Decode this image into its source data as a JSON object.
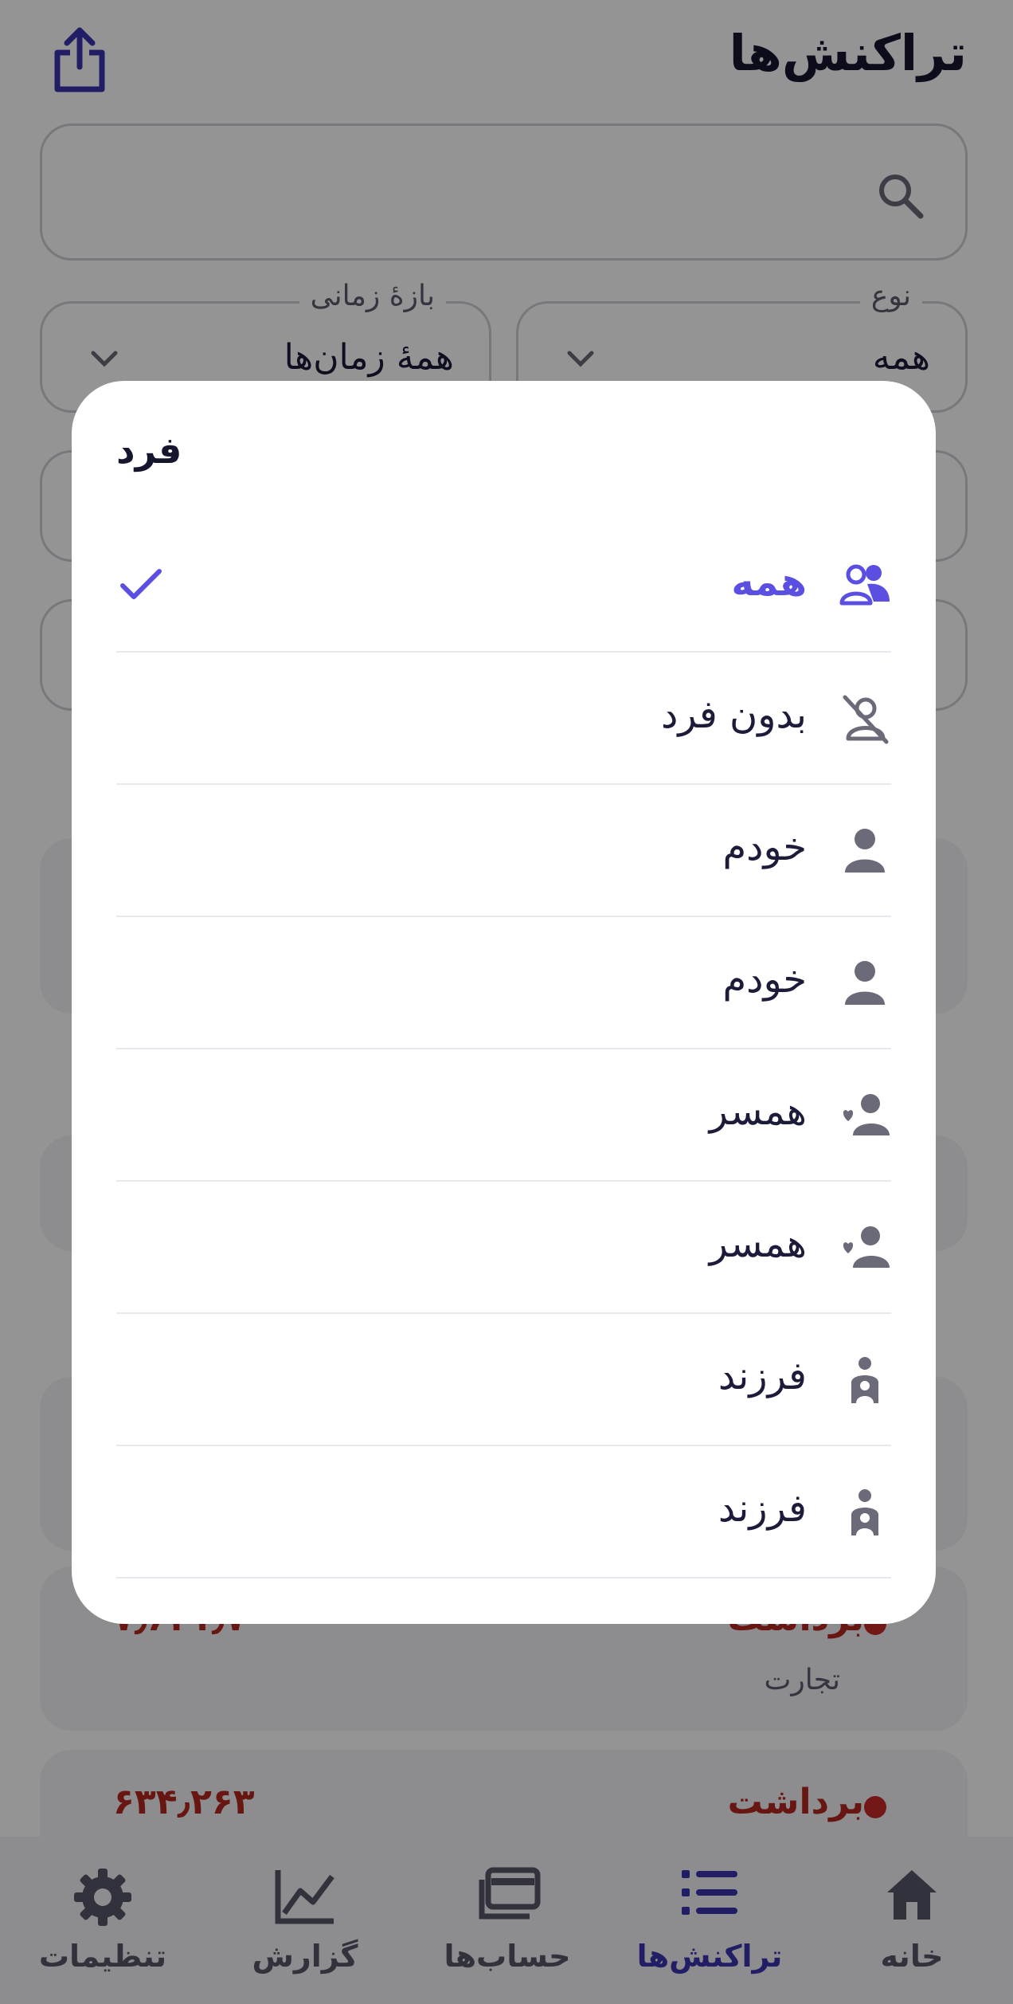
{
  "header": {
    "title": "تراکنش‌ها",
    "share_icon": "share-icon"
  },
  "search": {
    "placeholder": "",
    "icon": "search-icon"
  },
  "filters": {
    "type": {
      "label": "نوع",
      "value": "همه"
    },
    "period": {
      "label": "بازهٔ زمانی",
      "value": "همهٔ زمان‌ها"
    }
  },
  "transactions": [
    {
      "type": "برداشت",
      "category": "تجارت",
      "amount": "۷٫۶۳۱٫۷۰۰"
    },
    {
      "type": "برداشت",
      "amount": "۶۳۴٫۲۶۳"
    }
  ],
  "dialog": {
    "title": "فرد",
    "options": [
      {
        "label": "همه",
        "icon": "people-icon",
        "selected": true
      },
      {
        "label": "بدون فرد",
        "icon": "no-person-icon",
        "selected": false
      },
      {
        "label": "خودم",
        "icon": "person-icon",
        "selected": false
      },
      {
        "label": "خودم",
        "icon": "person-icon",
        "selected": false
      },
      {
        "label": "همسر",
        "icon": "spouse-icon",
        "selected": false
      },
      {
        "label": "همسر",
        "icon": "spouse-icon",
        "selected": false
      },
      {
        "label": "فرزند",
        "icon": "child-icon",
        "selected": false
      },
      {
        "label": "فرزند",
        "icon": "child-icon",
        "selected": false
      }
    ]
  },
  "nav": {
    "items": [
      {
        "label": "خانه",
        "icon": "home-icon",
        "active": false
      },
      {
        "label": "تراکنش‌ها",
        "icon": "list-icon",
        "active": true
      },
      {
        "label": "حساب‌ها",
        "icon": "accounts-icon",
        "active": false
      },
      {
        "label": "گزارش",
        "icon": "chart-icon",
        "active": false
      },
      {
        "label": "تنظیمات",
        "icon": "gear-icon",
        "active": false
      }
    ]
  },
  "colors": {
    "accent": "#5a4fe0",
    "nav_active": "#3a35b0",
    "withdrawal": "#b3261e",
    "scrim": "rgba(0,0,0,0.42)"
  }
}
